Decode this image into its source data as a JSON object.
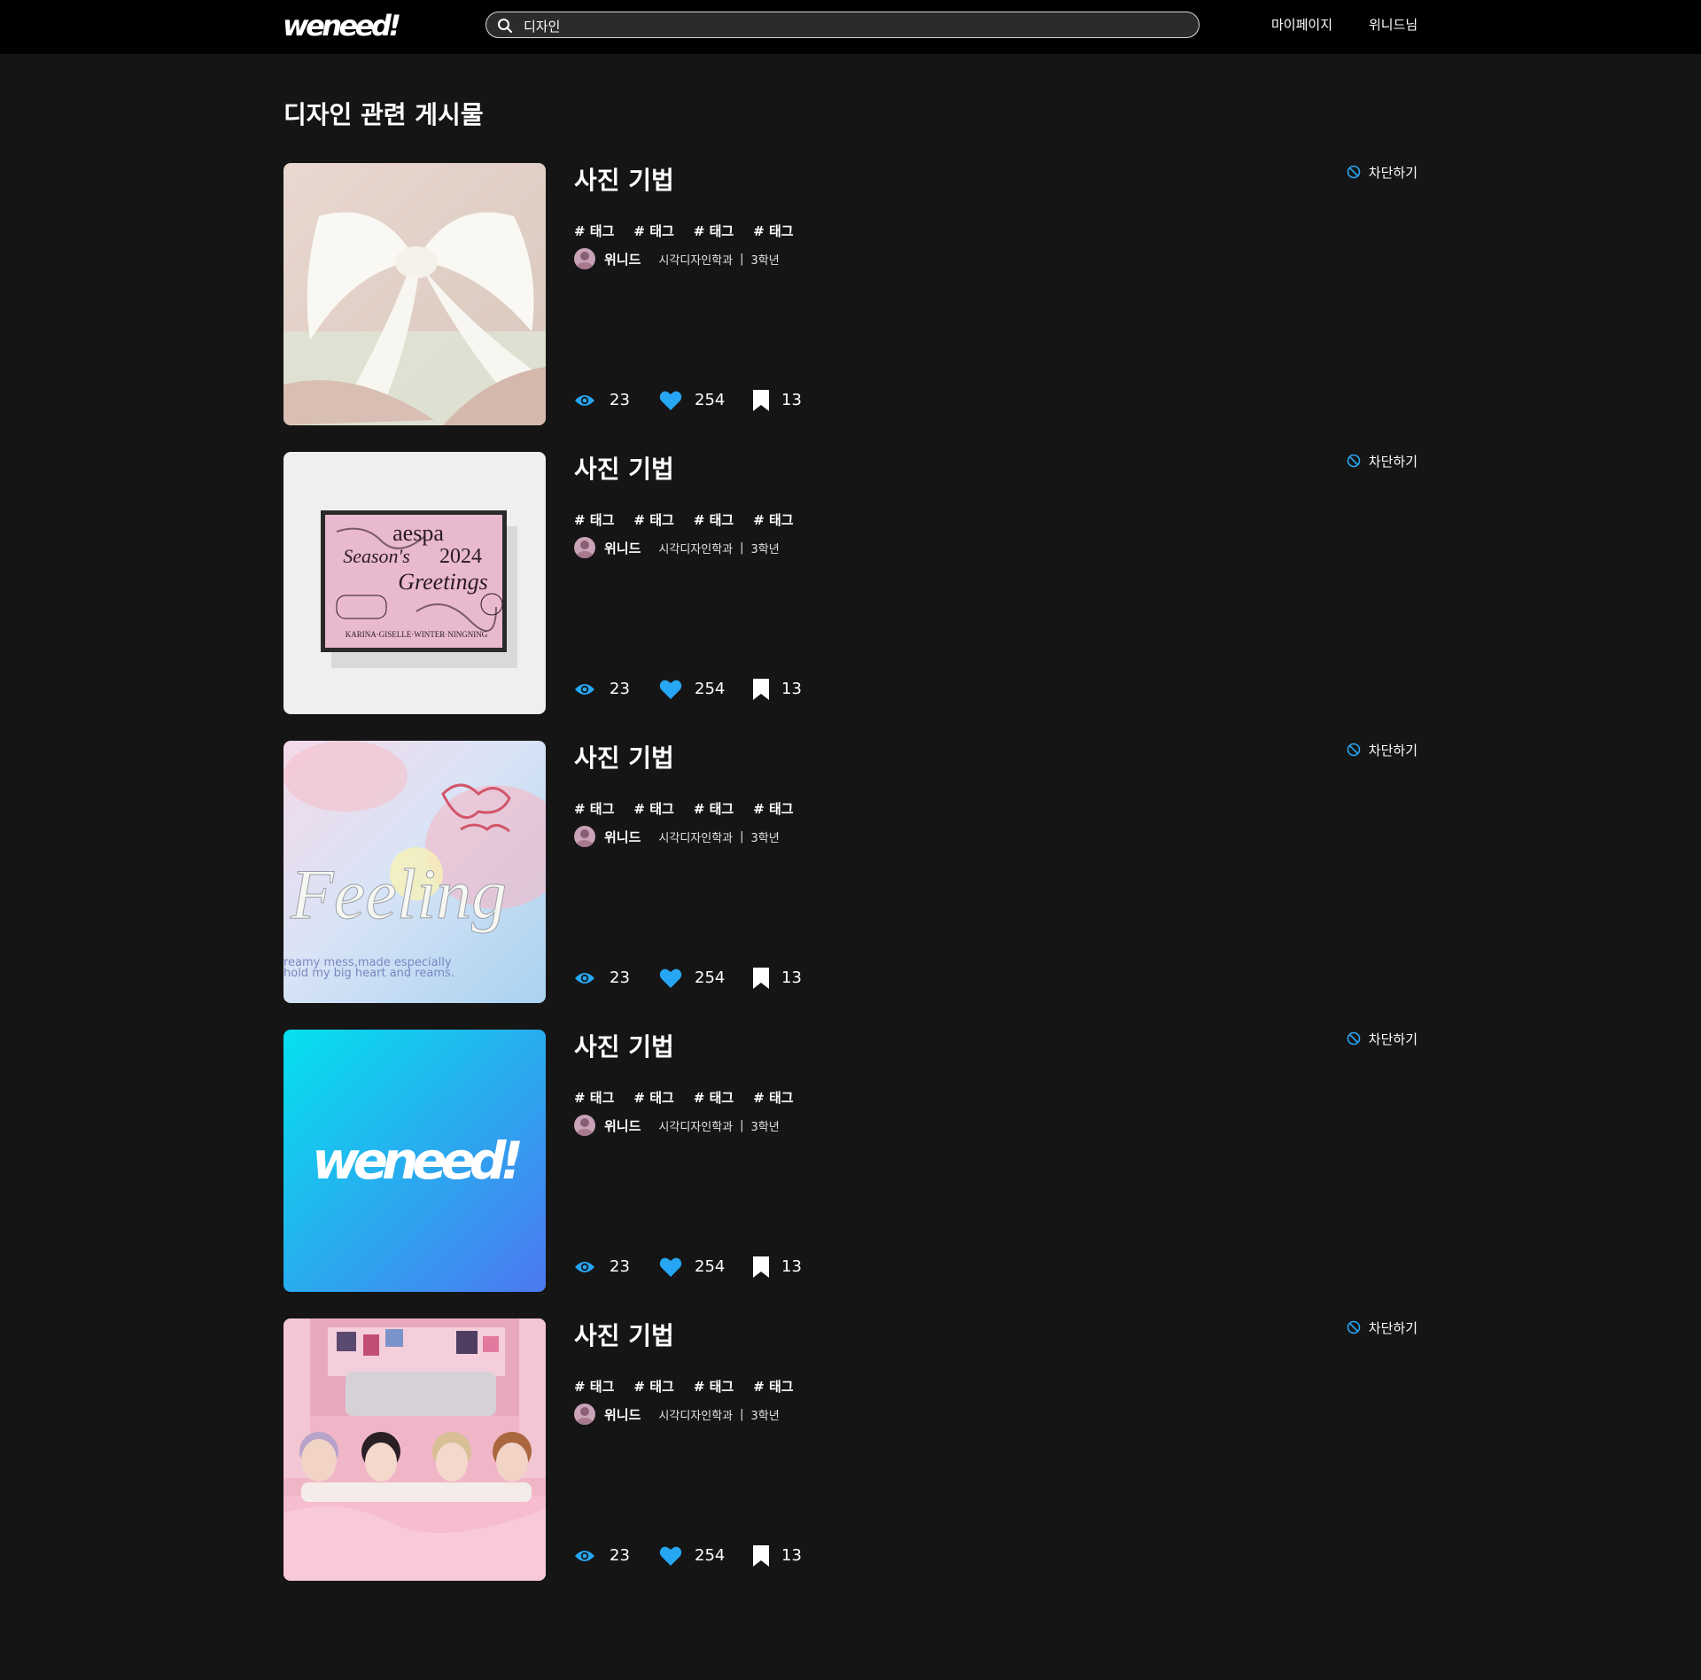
{
  "header": {
    "logo_text": "weneed!",
    "search": {
      "value": "디자인",
      "placeholder": ""
    },
    "nav": {
      "mypage": "마이페이지",
      "user": "위니드님"
    }
  },
  "page": {
    "title": "디자인 관련 게시물"
  },
  "colors": {
    "accent": "#27a6f4",
    "background": "#151515",
    "header": "#000000"
  },
  "posts": [
    {
      "title": "사진 기법",
      "tags": [
        "# 태그",
        "# 태그",
        "# 태그",
        "# 태그"
      ],
      "author": {
        "name": "위니드",
        "department": "시각디자인학과",
        "separator": "|",
        "year": "3학년"
      },
      "stats": {
        "views": "23",
        "likes": "254",
        "bookmarks": "13"
      },
      "block_label": "차단하기",
      "thumbnail": "white-ribbon-photo"
    },
    {
      "title": "사진 기법",
      "tags": [
        "# 태그",
        "# 태그",
        "# 태그",
        "# 태그"
      ],
      "author": {
        "name": "위니드",
        "department": "시각디자인학과",
        "separator": "|",
        "year": "3학년"
      },
      "stats": {
        "views": "23",
        "likes": "254",
        "bookmarks": "13"
      },
      "block_label": "차단하기",
      "thumbnail": "seasons-greetings-box",
      "thumb_text": {
        "brand": "aespa",
        "line1": "Season's",
        "year": "2024",
        "line2": "Greetings",
        "members": "KARINA·GISELLE·WINTER·NINGNING"
      }
    },
    {
      "title": "사진 기법",
      "tags": [
        "# 태그",
        "# 태그",
        "# 태그",
        "# 태그"
      ],
      "author": {
        "name": "위니드",
        "department": "시각디자인학과",
        "separator": "|",
        "year": "3학년"
      },
      "stats": {
        "views": "23",
        "likes": "254",
        "bookmarks": "13"
      },
      "block_label": "차단하기",
      "thumbnail": "feeling-artwork",
      "thumb_text": {
        "word": "Feeling",
        "line1": "reamy mess,made especially",
        "line2": "hold my big heart and reams."
      }
    },
    {
      "title": "사진 기법",
      "tags": [
        "# 태그",
        "# 태그",
        "# 태그",
        "# 태그"
      ],
      "author": {
        "name": "위니드",
        "department": "시각디자인학과",
        "separator": "|",
        "year": "3학년"
      },
      "stats": {
        "views": "23",
        "likes": "254",
        "bookmarks": "13"
      },
      "block_label": "차단하기",
      "thumbnail": "weneed-logo-gradient",
      "thumb_text": {
        "logo": "weneed!"
      }
    },
    {
      "title": "사진 기법",
      "tags": [
        "# 태그",
        "# 태그",
        "# 태그",
        "# 태그"
      ],
      "author": {
        "name": "위니드",
        "department": "시각디자인학과",
        "separator": "|",
        "year": "3학년"
      },
      "stats": {
        "views": "23",
        "likes": "254",
        "bookmarks": "13"
      },
      "block_label": "차단하기",
      "thumbnail": "group-photo-pink-room"
    }
  ]
}
